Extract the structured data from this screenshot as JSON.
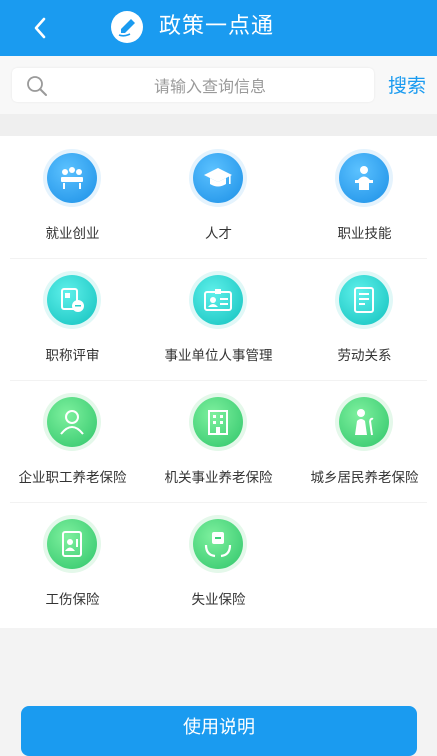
{
  "header": {
    "title": "政策一点通"
  },
  "search": {
    "placeholder": "请输入查询信息",
    "button_label": "搜索"
  },
  "categories": [
    {
      "label": "就业创业",
      "icon": "employment-meeting-icon"
    },
    {
      "label": "人才",
      "icon": "graduation-cap-icon"
    },
    {
      "label": "职业技能",
      "icon": "lecturer-podium-icon"
    },
    {
      "label": "职称评审",
      "icon": "certificate-review-icon"
    },
    {
      "label": "事业单位人事管理",
      "icon": "id-badge-icon"
    },
    {
      "label": "劳动关系",
      "icon": "contract-document-icon"
    },
    {
      "label": "企业职工养老保险",
      "icon": "users-group-icon"
    },
    {
      "label": "机关事业养老保险",
      "icon": "office-building-icon"
    },
    {
      "label": "城乡居民养老保险",
      "icon": "elderly-person-icon"
    },
    {
      "label": "工伤保险",
      "icon": "injury-card-icon"
    },
    {
      "label": "失业保险",
      "icon": "unemployment-hands-icon"
    }
  ],
  "footer": {
    "guide_button_label": "使用说明"
  },
  "colors": {
    "header_bg": "#1a9bf0",
    "accent": "#1a9bf0",
    "blue_icon": "#2aa2f0",
    "cyan_icon": "#25d0cc",
    "green_icon": "#3fd07a"
  }
}
